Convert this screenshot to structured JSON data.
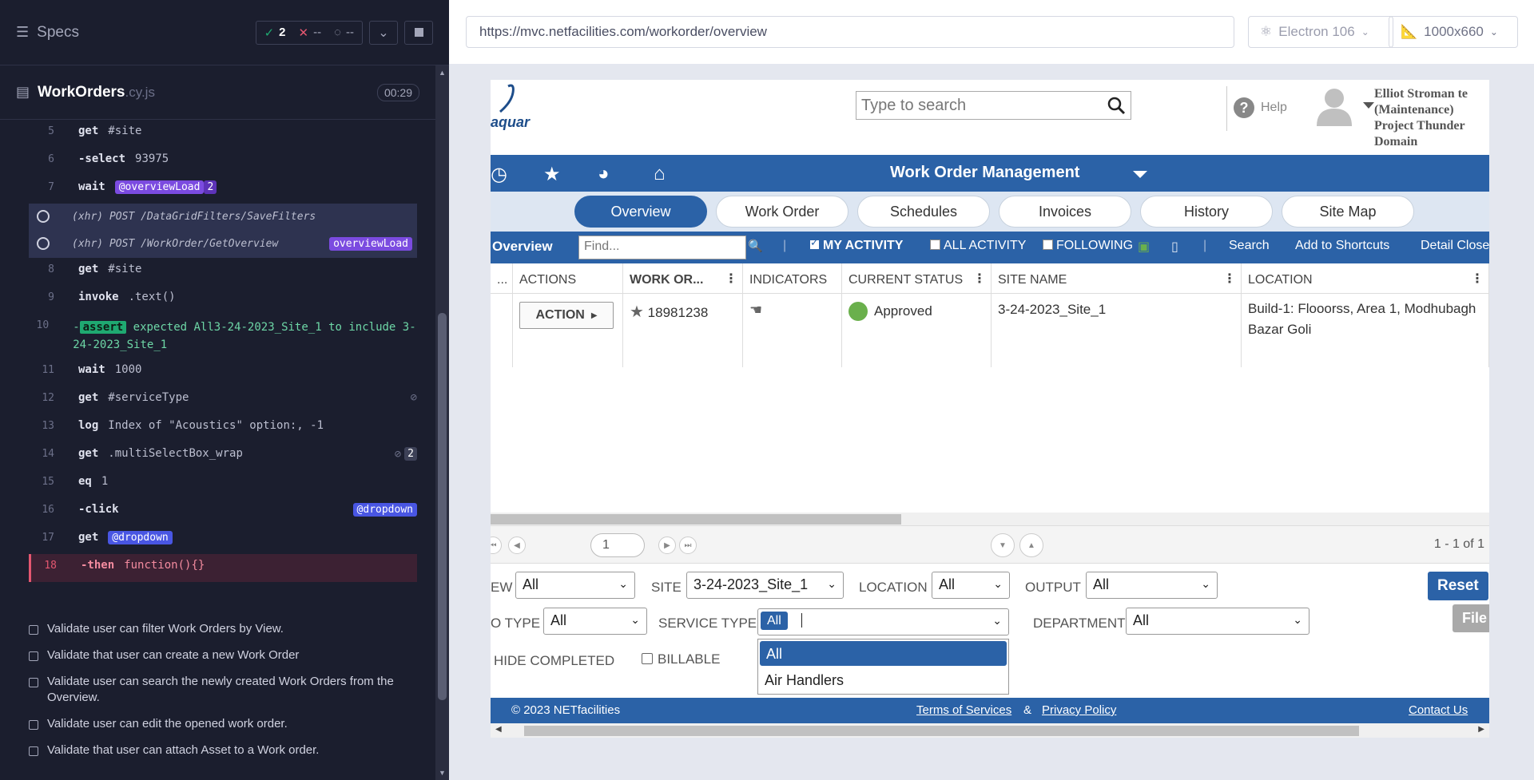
{
  "reporter": {
    "specs_label": "Specs",
    "stats": {
      "passed": "2",
      "failed": "--",
      "pending": "--"
    },
    "spec_name": "WorkOrders",
    "spec_ext": ".cy.js",
    "duration": "00:29",
    "commands": [
      {
        "num": "5",
        "name": "get",
        "msg": "#site"
      },
      {
        "num": "6",
        "name": "-select",
        "msg": "93975"
      },
      {
        "num": "7",
        "name": "wait",
        "alias": "@overviewLoad",
        "alias_count": "2"
      },
      {
        "num": "8",
        "name": "get",
        "msg": "#site"
      },
      {
        "num": "9",
        "name": "invoke",
        "msg": ".text()"
      },
      {
        "num": "10",
        "badge": "assert",
        "msg_a": "expected All3-24-2023_Site_1 to include 3-24-2023_Site_1"
      },
      {
        "num": "11",
        "name": "wait",
        "msg": "1000"
      },
      {
        "num": "12",
        "name": "get",
        "msg": "#serviceType"
      },
      {
        "num": "13",
        "name": "log",
        "msg": "Index of \"Acoustics\" option:, -1"
      },
      {
        "num": "14",
        "name": "get",
        "msg": ".multiSelectBox_wrap",
        "count": "2"
      },
      {
        "num": "15",
        "name": "eq",
        "msg": "1"
      },
      {
        "num": "16",
        "name": "-click",
        "alias": "@dropdown"
      },
      {
        "num": "17",
        "name": "get",
        "alias": "@dropdown"
      },
      {
        "num": "18",
        "name": "-then",
        "msg": "function(){}"
      }
    ],
    "xhr": [
      {
        "text": "(xhr)  POST /DataGridFilters/SaveFilters"
      },
      {
        "text": "(xhr)  POST /WorkOrder/GetOverview",
        "alias": "overviewLoad"
      }
    ],
    "tests": [
      "Validate user can filter Work Orders by View.",
      "Validate that user can create a new Work Order",
      "Validate user can search the newly created Work Orders from the Overview.",
      "Validate user can edit the opened work order.",
      "Validate that user can attach Asset to a Work order."
    ]
  },
  "aut_header": {
    "url": "https://mvc.netfacilities.com/workorder/overview",
    "browser": "Electron 106",
    "viewport": "1000x660"
  },
  "app": {
    "logo_text": "aquar",
    "search_placeholder": "Type to search",
    "help_label": "Help",
    "user_lines": [
      "Elliot Stroman te",
      "(Maintenance)",
      "Project Thunder",
      "Domain"
    ],
    "nav_title": "Work Order Management",
    "tabs": [
      "Overview",
      "Work Order",
      "Schedules",
      "Invoices",
      "History",
      "Site Map"
    ],
    "toolbar": {
      "title": "Overview",
      "find_placeholder": "Find...",
      "my_activity": "MY ACTIVITY",
      "all_activity": "ALL ACTIVITY",
      "following": "FOLLOWING",
      "search": "Search",
      "add_shortcuts": "Add to Shortcuts",
      "detail_close": "Detail Close"
    },
    "grid": {
      "headers": [
        "...",
        "ACTIONS",
        "WORK OR...",
        "INDICATORS",
        "CURRENT STATUS",
        "SITE NAME",
        "LOCATION"
      ],
      "row": {
        "action": "ACTION",
        "work_order": "18981238",
        "status": "Approved",
        "site": "3-24-2023_Site_1",
        "location": "Build-1: Flooorss, Area 1, Modhubagh Bazar Goli"
      }
    },
    "pager": {
      "page": "1",
      "summary": "1 - 1 of 1"
    },
    "filters": {
      "view_label": "EW",
      "view_value": "All",
      "site_label": "SITE",
      "site_value": "3-24-2023_Site_1",
      "location_label": "LOCATION",
      "location_value": "All",
      "output_label": "OUTPUT",
      "output_value": "All",
      "reset": "Reset",
      "wo_type_label": "O TYPE",
      "wo_type_value": "All",
      "service_type_label": "SERVICE TYPE",
      "service_chip": "All",
      "department_label": "DEPARTMENT",
      "department_value": "All",
      "file_label": "File",
      "hide_completed": "HIDE COMPLETED",
      "billable": "BILLABLE",
      "dropdown_options": [
        "All",
        "Air Handlers"
      ]
    },
    "footer": {
      "copyright": "© 2023 NETfacilities",
      "terms": "Terms of Services",
      "amp": "&",
      "privacy": "Privacy Policy",
      "contact": "Contact Us"
    }
  },
  "colors": {
    "app_blue": "#2b62a7",
    "status_green": "#6ab04c",
    "reporter_bg": "#1b1e2e",
    "alias_purple": "#7b4be0",
    "alias_blue": "#4956e3",
    "fail_red": "#e45770",
    "pass_green": "#1fa971"
  }
}
